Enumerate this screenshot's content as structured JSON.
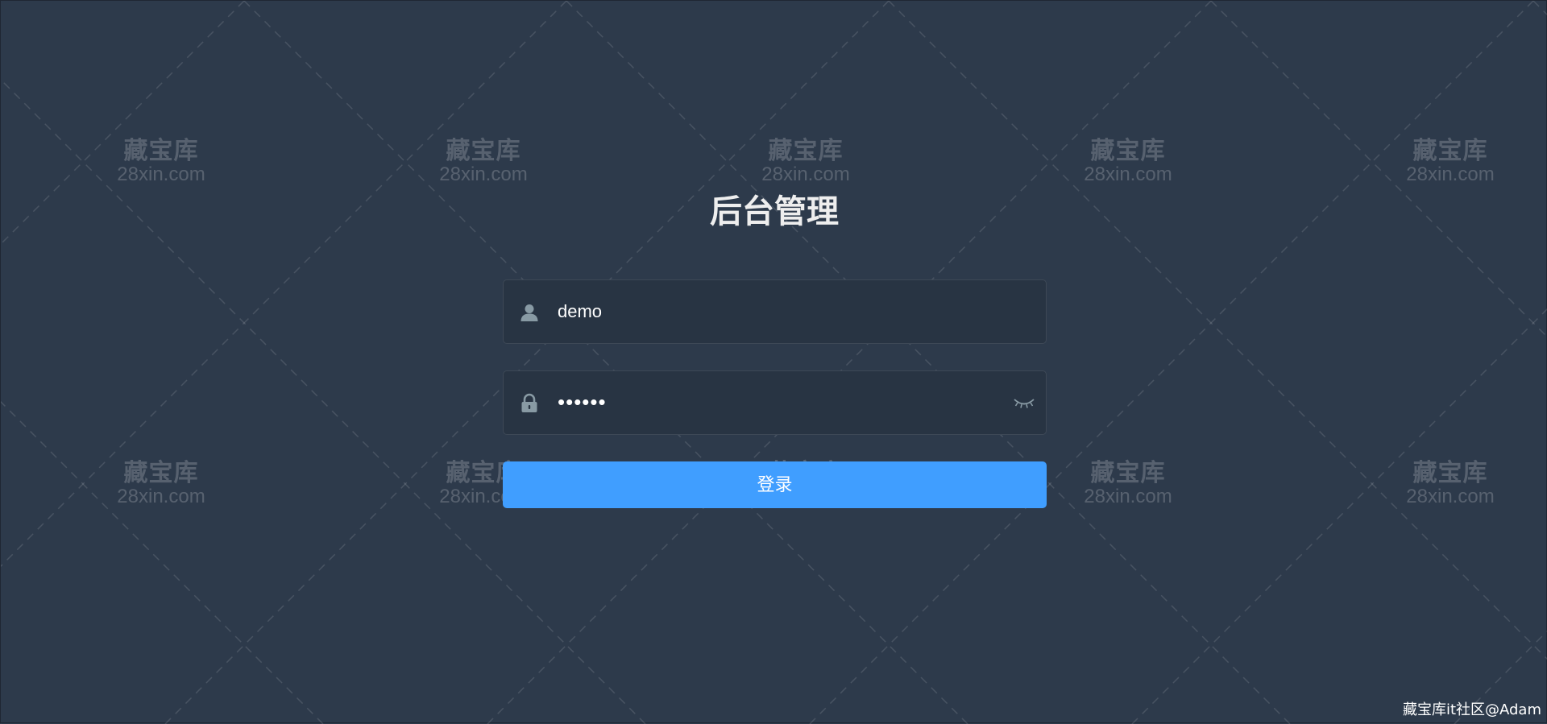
{
  "colors": {
    "background": "#2d3a4b",
    "field_background": "#283443",
    "button": "#409eff",
    "text": "#ffffff",
    "icon": "#889aa4"
  },
  "login": {
    "title": "后台管理",
    "username_value": "demo",
    "password_value": "••••••",
    "username_icon": "user-icon",
    "password_icon": "lock-icon",
    "toggle_icon": "eye-closed-icon",
    "submit_label": "登录"
  },
  "watermark": {
    "line1": "藏宝库",
    "line2": "28xin.com"
  },
  "footer": {
    "credit": "藏宝库it社区@Adam"
  }
}
